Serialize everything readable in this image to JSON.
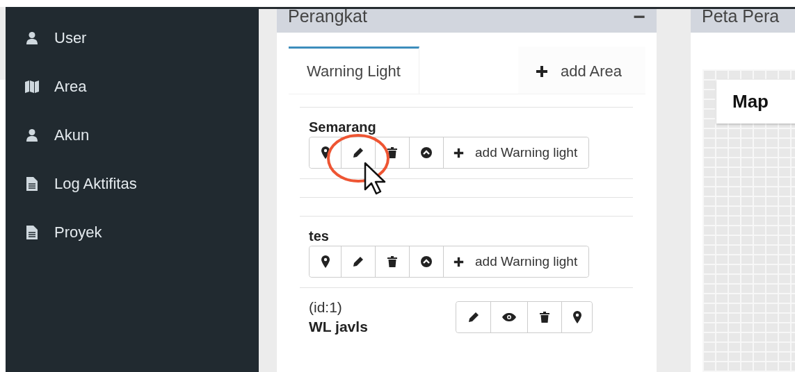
{
  "sidebar": {
    "items": [
      {
        "label": "User",
        "kind": "user"
      },
      {
        "label": "Area",
        "kind": "map"
      },
      {
        "label": "Akun",
        "kind": "user"
      },
      {
        "label": "Log Aktifitas",
        "kind": "file"
      },
      {
        "label": "Proyek",
        "kind": "file"
      }
    ]
  },
  "device_panel": {
    "title": "Perangkat",
    "collapse_symbol": "−",
    "tabs": [
      {
        "label": "Warning Light",
        "selected": true,
        "kind": "tab"
      },
      {
        "label": "add Area",
        "selected": false,
        "kind": "add"
      }
    ],
    "areas": [
      {
        "name": "Semarang",
        "add_label": "add Warning light"
      },
      {
        "name": "tes",
        "add_label": "add Warning light",
        "lights": [
          {
            "id": "(id:1)",
            "name": "WL javls"
          }
        ]
      }
    ]
  },
  "map_panel": {
    "title": "Peta Pera",
    "map_button": "Map"
  }
}
